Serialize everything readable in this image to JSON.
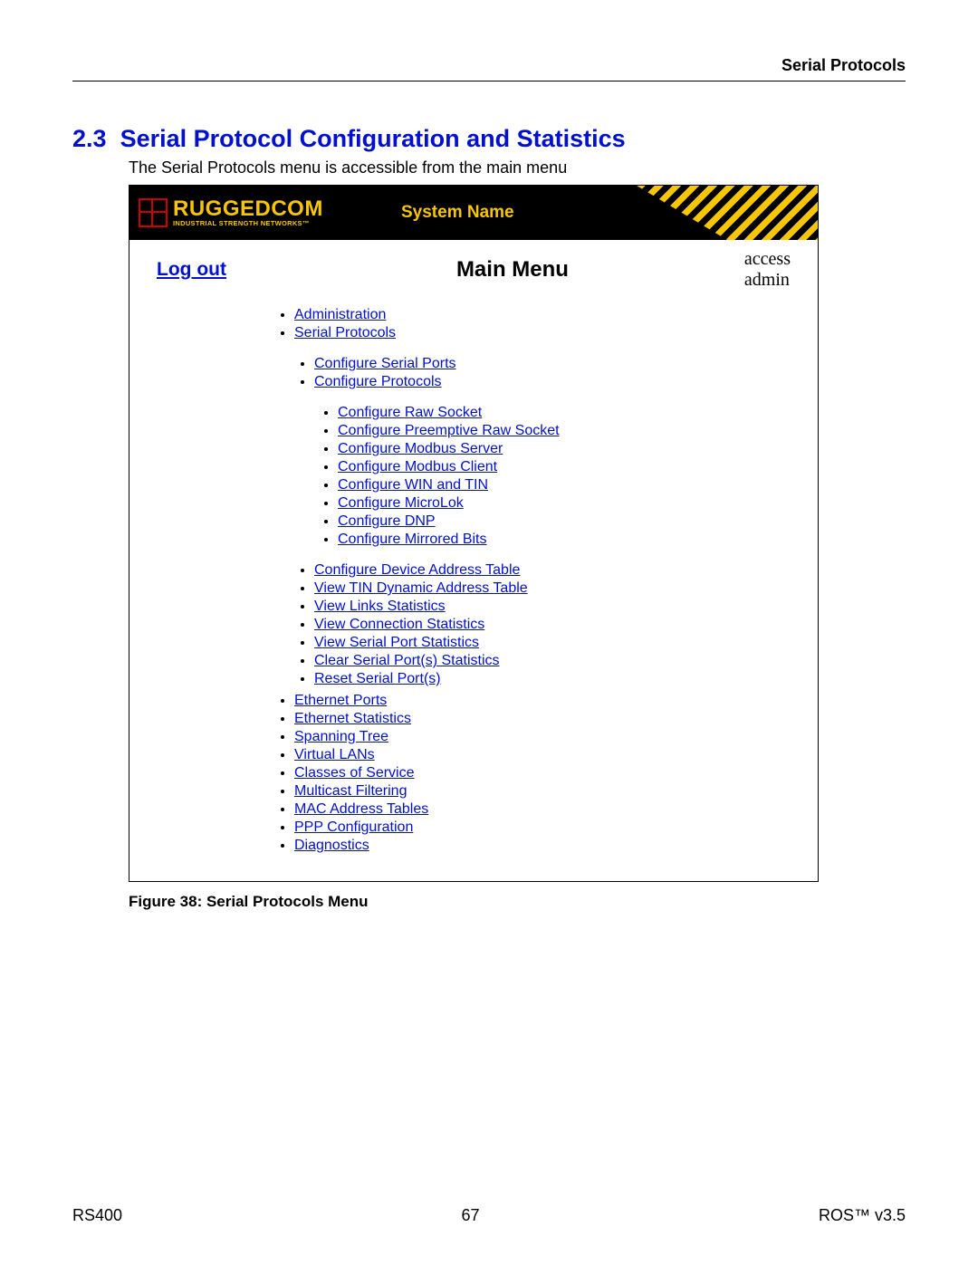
{
  "doc": {
    "header_right": "Serial Protocols",
    "section_number": "2.3",
    "section_title": "Serial Protocol Configuration and Statistics",
    "intro": "The Serial Protocols menu is accessible from the main menu",
    "figure_caption": "Figure 38: Serial Protocols Menu",
    "footer_left": "RS400",
    "footer_center": "67",
    "footer_right": "ROS™  v3.5"
  },
  "screenshot": {
    "logo_main": "RUGGEDCOM",
    "logo_sub": "INDUSTRIAL STRENGTH NETWORKS™",
    "system_name": "System Name",
    "logout": "Log out",
    "main_menu_title": "Main Menu",
    "access_line1": "access",
    "access_line2": "admin",
    "menu_level1a": [
      "Administration",
      "Serial Protocols"
    ],
    "menu_level2a": [
      "Configure Serial Ports",
      "Configure Protocols"
    ],
    "menu_level3": [
      "Configure Raw Socket",
      "Configure Preemptive Raw Socket",
      "Configure Modbus Server",
      "Configure Modbus Client",
      "Configure WIN and TIN",
      "Configure MicroLok",
      "Configure DNP",
      "Configure Mirrored Bits"
    ],
    "menu_level2b": [
      "Configure Device Address Table",
      "View TIN Dynamic Address Table",
      "View Links Statistics",
      "View Connection Statistics",
      "View Serial Port Statistics",
      "Clear Serial Port(s) Statistics",
      "Reset Serial Port(s)"
    ],
    "menu_level1b": [
      "Ethernet Ports",
      "Ethernet Statistics",
      "Spanning Tree",
      "Virtual LANs",
      "Classes of Service",
      "Multicast Filtering",
      "MAC Address Tables",
      "PPP Configuration",
      "Diagnostics"
    ]
  }
}
